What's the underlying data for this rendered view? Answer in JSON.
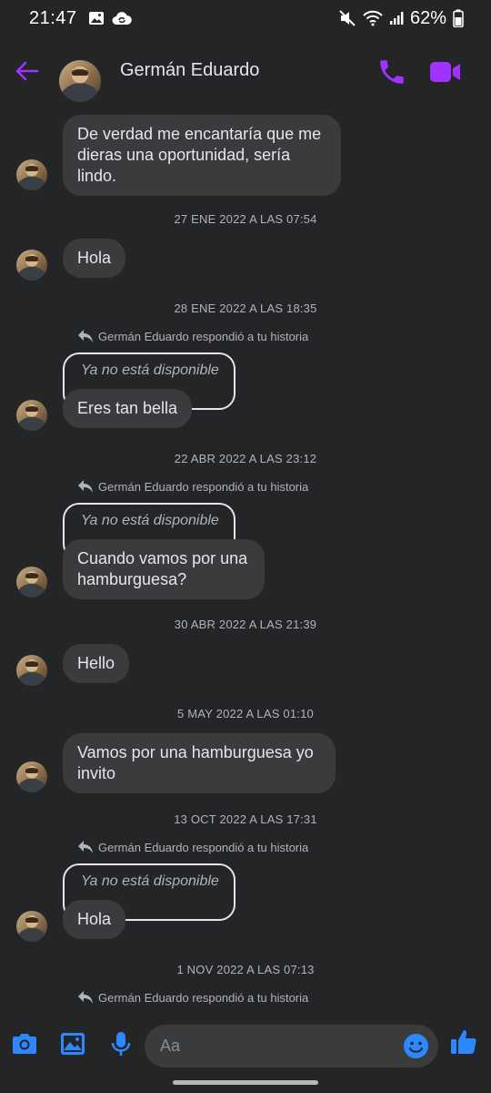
{
  "status_bar": {
    "time": "21:47",
    "battery": "62%",
    "icons": [
      "gallery-icon",
      "cloud-sync-icon",
      "mute-icon",
      "wifi-icon",
      "signal-icon",
      "battery-icon"
    ]
  },
  "header": {
    "contact_name": "Germán Eduardo",
    "accent_color": "#a033ff"
  },
  "messages": [
    {
      "type": "text",
      "text": "De verdad me encantaría que me dieras una oportunidad, sería lindo."
    },
    {
      "type": "timestamp",
      "text": "27 ENE 2022 A LAS 07:54"
    },
    {
      "type": "text",
      "text": "Hola"
    },
    {
      "type": "timestamp",
      "text": "28 ENE 2022 A LAS 18:35"
    },
    {
      "type": "story_reply",
      "reply_label": "Germán Eduardo respondió a tu historia",
      "story_text": "Ya no está disponible",
      "text": "Eres tan bella"
    },
    {
      "type": "timestamp",
      "text": "22 ABR 2022 A LAS 23:12"
    },
    {
      "type": "story_reply",
      "reply_label": "Germán Eduardo respondió a tu historia",
      "story_text": "Ya no está disponible",
      "text": "Cuando vamos por una hamburguesa?"
    },
    {
      "type": "timestamp",
      "text": "30 ABR 2022 A LAS 21:39"
    },
    {
      "type": "text",
      "text": "Hello"
    },
    {
      "type": "timestamp",
      "text": "5 MAY 2022 A LAS 01:10"
    },
    {
      "type": "text",
      "text": "Vamos por una hamburguesa yo invito"
    },
    {
      "type": "timestamp",
      "text": "13 OCT 2022 A LAS 17:31"
    },
    {
      "type": "story_reply",
      "reply_label": "Germán Eduardo respondió a tu historia",
      "story_text": "Ya no está disponible",
      "text": "Hola"
    },
    {
      "type": "timestamp",
      "text": "1 NOV 2022 A LAS 07:13"
    },
    {
      "type": "reply_label",
      "text": "Germán Eduardo respondió a tu historia"
    }
  ],
  "composer": {
    "placeholder": "Aa",
    "icons": [
      "camera-icon",
      "image-icon",
      "microphone-icon",
      "emoji-icon",
      "thumbs-up-icon"
    ]
  }
}
